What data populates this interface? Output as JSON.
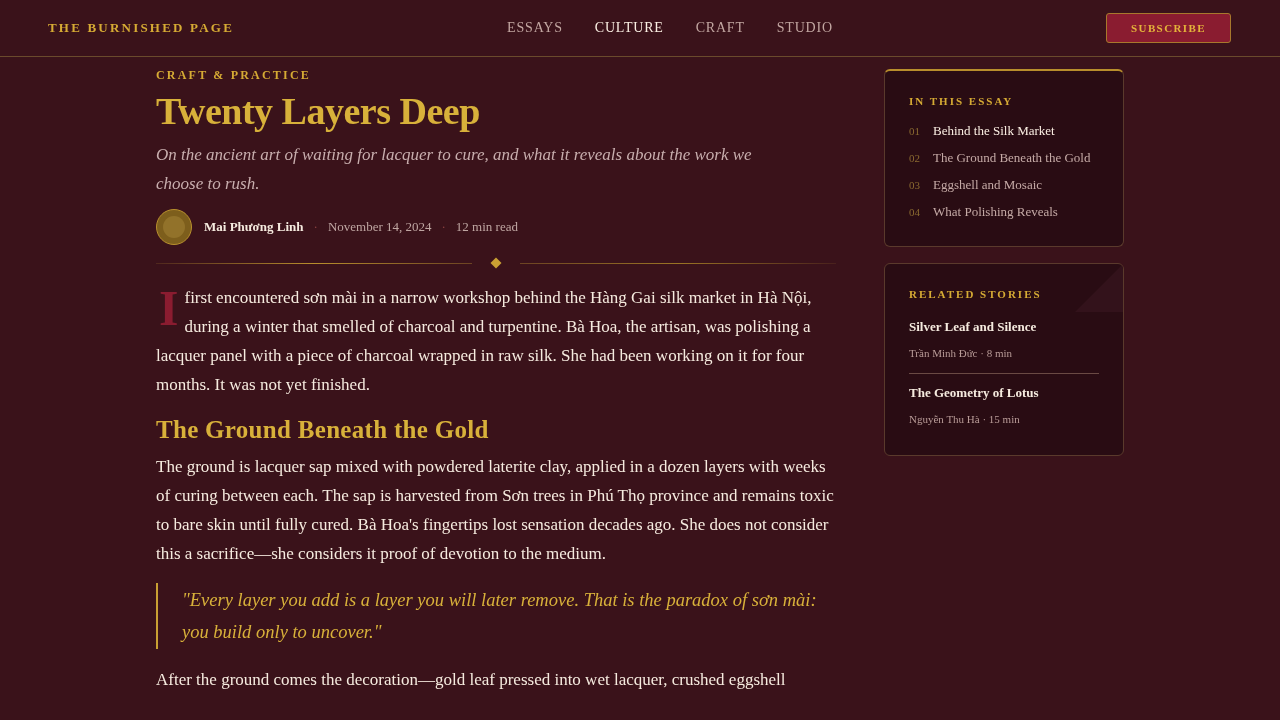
{
  "site": {
    "logo": "THE BURNISHED PAGE",
    "nav": [
      {
        "label": "ESSAYS",
        "selected": false
      },
      {
        "label": "CULTURE",
        "selected": true
      },
      {
        "label": "CRAFT",
        "selected": false
      },
      {
        "label": "STUDIO",
        "selected": false
      }
    ],
    "subscribe": "SUBSCRIBE"
  },
  "article": {
    "category": "CRAFT & PRACTICE",
    "title": "Twenty Layers Deep",
    "subtitle": "On the ancient art of waiting for lacquer to cure, and what it reveals about the work we choose to rush.",
    "meta": [
      {
        "kind": "author",
        "text": "Mai Phương Linh"
      },
      {
        "kind": "separator",
        "text": "·"
      },
      {
        "kind": "date",
        "text": "November 14, 2024"
      },
      {
        "kind": "separator",
        "text": "·"
      },
      {
        "kind": "read_time",
        "text": "12 min read"
      }
    ],
    "body": [
      {
        "kind": "lead",
        "text": "I first encountered sơn mài in a narrow workshop behind the Hàng Gai silk market in Hà Nội, during a winter that smelled of charcoal and turpentine. Bà Hoa, the artisan, was polishing a lacquer panel with a piece of charcoal wrapped in raw silk. She had been working on it for four months. It was not yet finished."
      },
      {
        "kind": "heading",
        "text": "The Ground Beneath the Gold"
      },
      {
        "kind": "paragraph",
        "text": "The ground is lacquer sap mixed with powdered laterite clay, applied in a dozen layers with weeks of curing between each. The sap is harvested from Sơn trees in Phú Thọ province and remains toxic to bare skin until fully cured. Bà Hoa's fingertips lost sensation decades ago. She does not consider this a sacrifice—she considers it proof of devotion to the medium."
      },
      {
        "kind": "quote",
        "text": "\"Every layer you add is a layer you will later remove. That is the paradox of sơn mài: you build only to uncover.\""
      },
      {
        "kind": "paragraph",
        "text": "After the ground comes the decoration—gold leaf pressed into wet lacquer, crushed eggshell"
      }
    ]
  },
  "sidebar": {
    "toc": {
      "heading": "IN THIS ESSAY",
      "items": [
        {
          "number": "01",
          "label": "Behind the Silk Market",
          "selected": true
        },
        {
          "number": "02",
          "label": "The Ground Beneath the Gold",
          "selected": false
        },
        {
          "number": "03",
          "label": "Eggshell and Mosaic",
          "selected": false
        },
        {
          "number": "04",
          "label": "What Polishing Reveals",
          "selected": false
        }
      ]
    },
    "related": {
      "heading": "RELATED STORIES",
      "stories": [
        {
          "title": "Silver Leaf and Silence",
          "meta": "Trần Minh Đức · 8 min"
        },
        {
          "title": "The Geometry of Lotus",
          "meta": "Nguyễn Thu Hà · 15 min"
        }
      ]
    }
  }
}
